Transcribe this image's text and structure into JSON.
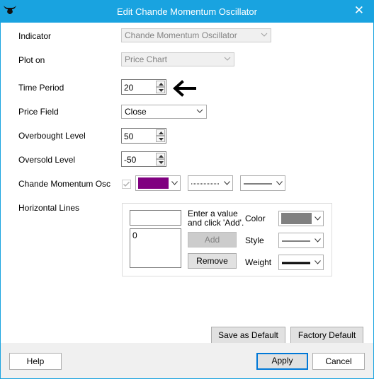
{
  "window": {
    "title": "Edit Chande Momentum Oscillator",
    "close_glyph": "✕"
  },
  "form": {
    "indicator": {
      "label": "Indicator",
      "value": "Chande Momentum Oscillator"
    },
    "plot_on": {
      "label": "Plot on",
      "value": "Price Chart"
    },
    "time_period": {
      "label": "Time Period",
      "value": "20"
    },
    "price_field": {
      "label": "Price Field",
      "value": "Close"
    },
    "overbought": {
      "label": "Overbought Level",
      "value": "50"
    },
    "oversold": {
      "label": "Oversold Level",
      "value": "-50"
    },
    "cmo": {
      "label": "Chande Momentum Osc",
      "color": "#800080",
      "line_style": "dotted",
      "line_weight": "thin"
    }
  },
  "horizontal_lines": {
    "label": "Horizontal Lines",
    "input_value": "",
    "hint": "Enter a value and click 'Add'.",
    "hint_line1": "Enter a value",
    "hint_line2": "and click 'Add'.",
    "list_items": [
      "0"
    ],
    "add_label": "Add",
    "remove_label": "Remove",
    "color_label": "Color",
    "style_label": "Style",
    "weight_label": "Weight",
    "color_value": "#808080"
  },
  "buttons": {
    "save_default": "Save as Default",
    "factory_default": "Factory Default",
    "help": "Help",
    "apply": "Apply",
    "cancel": "Cancel"
  },
  "icons": {
    "app": "bull-icon",
    "pointer": "left-arrow-icon"
  }
}
